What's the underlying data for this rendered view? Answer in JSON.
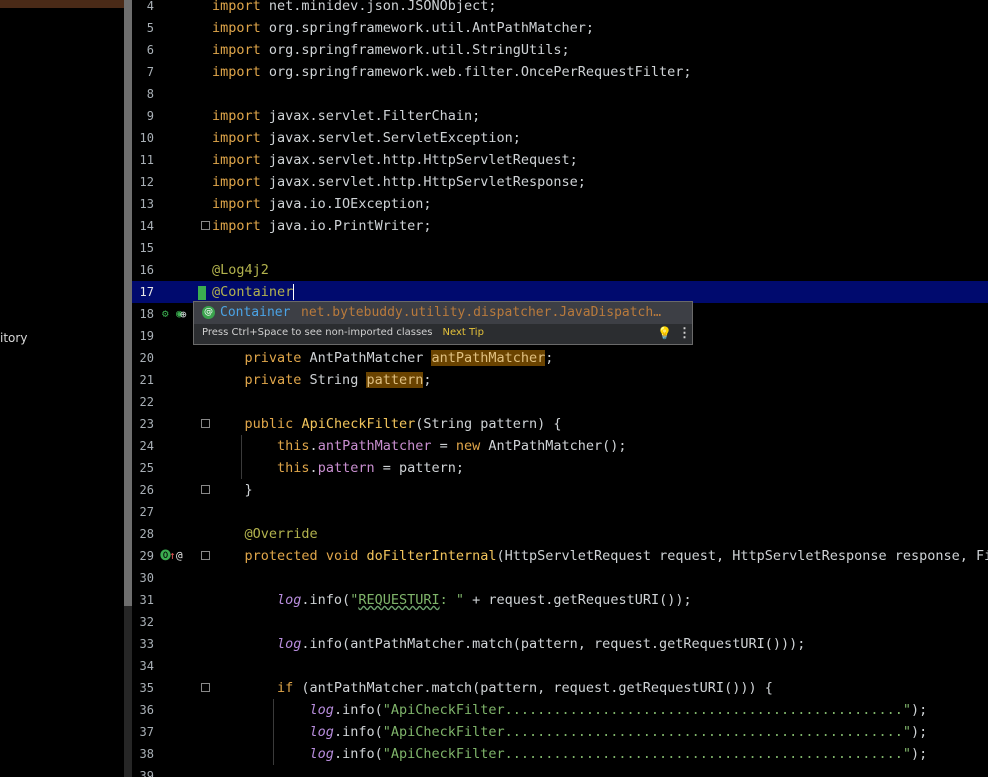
{
  "left_panel": {
    "partial_text": "itory"
  },
  "editor": {
    "current_line": 17,
    "lines": [
      {
        "n": 4,
        "code": "import net.minidev.json.JSONObject;"
      },
      {
        "n": 5,
        "code": "import org.springframework.util.AntPathMatcher;"
      },
      {
        "n": 6,
        "code": "import org.springframework.util.StringUtils;"
      },
      {
        "n": 7,
        "code": "import org.springframework.web.filter.OncePerRequestFilter;"
      },
      {
        "n": 8,
        "code": ""
      },
      {
        "n": 9,
        "code": "import javax.servlet.FilterChain;"
      },
      {
        "n": 10,
        "code": "import javax.servlet.ServletException;"
      },
      {
        "n": 11,
        "code": "import javax.servlet.http.HttpServletRequest;"
      },
      {
        "n": 12,
        "code": "import javax.servlet.http.HttpServletResponse;"
      },
      {
        "n": 13,
        "code": "import java.io.IOException;"
      },
      {
        "n": 14,
        "code": "import java.io.PrintWriter;"
      },
      {
        "n": 15,
        "code": ""
      },
      {
        "n": 16,
        "code": "@Log4j2"
      },
      {
        "n": 17,
        "code": "@Container"
      },
      {
        "n": 18,
        "code": ""
      },
      {
        "n": 19,
        "code": ""
      },
      {
        "n": 20,
        "code": "    private AntPathMatcher antPathMatcher;"
      },
      {
        "n": 21,
        "code": "    private String pattern;"
      },
      {
        "n": 22,
        "code": ""
      },
      {
        "n": 23,
        "code": "    public ApiCheckFilter(String pattern) {"
      },
      {
        "n": 24,
        "code": "        this.antPathMatcher = new AntPathMatcher();"
      },
      {
        "n": 25,
        "code": "        this.pattern = pattern;"
      },
      {
        "n": 26,
        "code": "    }"
      },
      {
        "n": 27,
        "code": ""
      },
      {
        "n": 28,
        "code": "    @Override"
      },
      {
        "n": 29,
        "code": "    protected void doFilterInternal(HttpServletRequest request, HttpServletResponse response, Fil"
      },
      {
        "n": 30,
        "code": ""
      },
      {
        "n": 31,
        "code": "        log.info(\"REQUESTURI: \" + request.getRequestURI());"
      },
      {
        "n": 32,
        "code": ""
      },
      {
        "n": 33,
        "code": "        log.info(antPathMatcher.match(pattern, request.getRequestURI()));"
      },
      {
        "n": 34,
        "code": ""
      },
      {
        "n": 35,
        "code": "        if (antPathMatcher.match(pattern, request.getRequestURI())) {"
      },
      {
        "n": 36,
        "code": "            log.info(\"ApiCheckFilter.................................................\");"
      },
      {
        "n": 37,
        "code": "            log.info(\"ApiCheckFilter.................................................\");"
      },
      {
        "n": 38,
        "code": "            log.info(\"ApiCheckFilter.................................................\");"
      },
      {
        "n": 39,
        "code": ""
      }
    ]
  },
  "completion_popup": {
    "item_icon": "annotation-icon",
    "item_name": "Container",
    "item_package": "net.bytebuddy.utility.dispatcher.JavaDispatch…",
    "hint": "Press Ctrl+Space to see non-imported classes",
    "tip_link": "Next Tip",
    "bulb_icon": "lightbulb-icon",
    "menu_icon": "more-vertical-icon"
  },
  "colors": {
    "background": "#000000",
    "current_line": "#000a6e",
    "keyword": "#e0a64a",
    "annotation": "#b3b34e",
    "string": "#7fb46a",
    "highlight": "#6a4300",
    "change_bar": "#3bad50"
  }
}
